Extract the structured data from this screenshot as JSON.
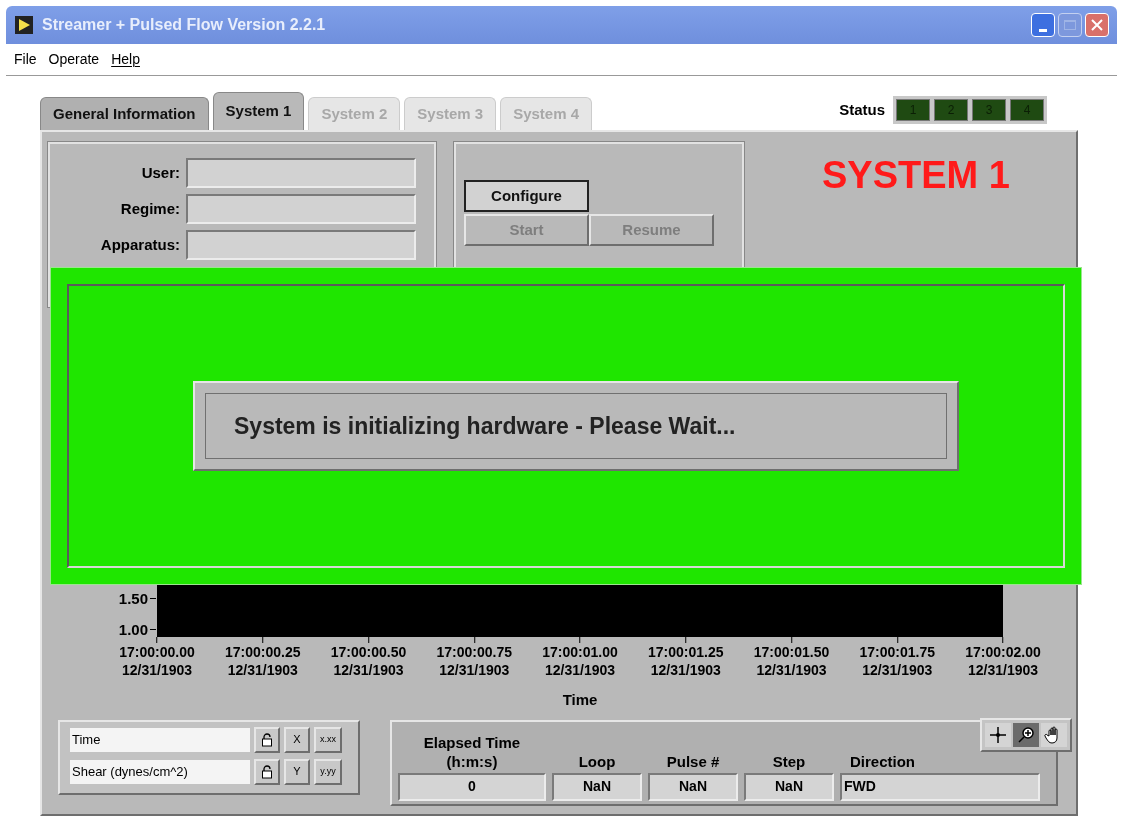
{
  "window": {
    "title": "Streamer + Pulsed Flow Version 2.2.1"
  },
  "menu": [
    {
      "label": "File",
      "mnemonic": false
    },
    {
      "label": "Operate",
      "mnemonic": false
    },
    {
      "label": "Help",
      "mnemonic": true
    }
  ],
  "tabs": [
    {
      "label": "General Information",
      "selected": false,
      "disabled": false
    },
    {
      "label": "System 1",
      "selected": true,
      "disabled": false
    },
    {
      "label": "System 2",
      "selected": false,
      "disabled": true
    },
    {
      "label": "System 3",
      "selected": false,
      "disabled": true
    },
    {
      "label": "System 4",
      "selected": false,
      "disabled": true
    }
  ],
  "status": {
    "label": "Status",
    "leds": [
      {
        "label": "1",
        "on": false
      },
      {
        "label": "2",
        "on": false
      },
      {
        "label": "3",
        "on": false
      },
      {
        "label": "4",
        "on": false
      }
    ]
  },
  "info_fields": [
    {
      "label": "User:"
    },
    {
      "label": "Regime:"
    },
    {
      "label": "Apparatus:"
    }
  ],
  "controls": [
    {
      "label": "Configure",
      "disabled": false
    },
    {
      "label": "Start",
      "disabled": true
    },
    {
      "label": "Resume",
      "disabled": true
    }
  ],
  "system_title": "SYSTEM 1",
  "chart": {
    "x_axis_title": "Time",
    "y_tick_labels": [
      "1.50",
      "1.00"
    ],
    "x_tick_labels": [
      "17:00:00.00\n12/31/1903",
      "17:00:00.25\n12/31/1903",
      "17:00:00.50\n12/31/1903",
      "17:00:00.75\n12/31/1903",
      "17:00:01.00\n12/31/1903",
      "17:00:01.25\n12/31/1903",
      "17:00:01.50\n12/31/1903",
      "17:00:01.75\n12/31/1903",
      "17:00:02.00\n12/31/1903"
    ]
  },
  "legend": [
    {
      "name": "Time",
      "axis": "X",
      "format": "x.xx"
    },
    {
      "name": "Shear (dynes/cm^2)",
      "axis": "Y",
      "format": "y.yy"
    }
  ],
  "readouts": [
    {
      "label": "Elapsed Time\n(h:m:s)",
      "value": "0",
      "kind": "number"
    },
    {
      "label": "Loop",
      "value": "NaN",
      "kind": "number"
    },
    {
      "label": "Pulse #",
      "value": "NaN",
      "kind": "number"
    },
    {
      "label": "Step",
      "value": "NaN",
      "kind": "number"
    },
    {
      "label": "Direction",
      "value": "FWD",
      "kind": "text"
    }
  ],
  "tools": [
    {
      "kind": "crosshair",
      "selected": false
    },
    {
      "kind": "zoom",
      "selected": true
    },
    {
      "kind": "pan",
      "selected": false
    }
  ],
  "overlay": {
    "message": "System is initializing hardware - Please Wait..."
  }
}
